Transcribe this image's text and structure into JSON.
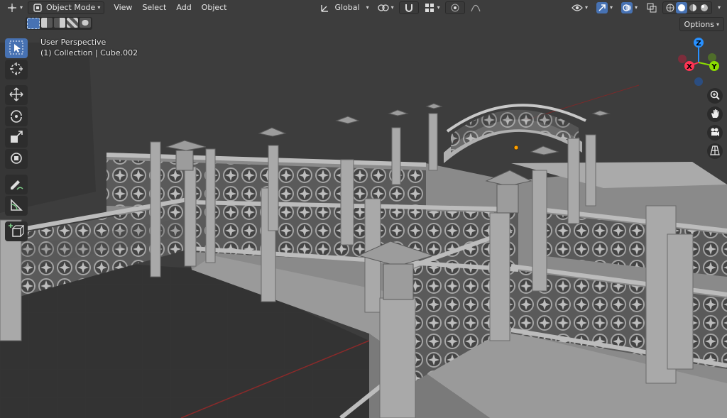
{
  "header": {
    "mode_label": "Object Mode",
    "menus": [
      "View",
      "Select",
      "Add",
      "Object"
    ],
    "transform_orientation": "Global"
  },
  "options_label": "Options",
  "viewport_info": {
    "line1": "User Perspective",
    "line2": "(1) Collection | Cube.002"
  },
  "gizmo": {
    "z": "Z",
    "y": "Y",
    "x": "X"
  },
  "colors": {
    "accent": "#4772b3",
    "axis_x": "#ff3352",
    "axis_y": "#8bdc00",
    "axis_z": "#2890ff",
    "origin": "#ffa000"
  },
  "tools": [
    "select-box",
    "cursor",
    "move",
    "rotate",
    "scale",
    "transform",
    "annotate",
    "measure",
    "add-cube"
  ],
  "nav": [
    "zoom-icon",
    "hand-icon",
    "camera-icon",
    "grid-icon"
  ]
}
